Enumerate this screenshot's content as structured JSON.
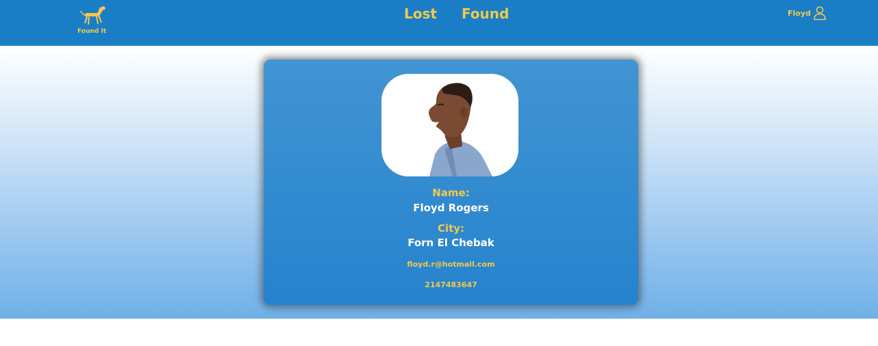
{
  "brand": {
    "name": "Found It",
    "icon": "dog-icon"
  },
  "nav": {
    "lost_label": "Lost",
    "found_label": "Found"
  },
  "user": {
    "name": "Floyd",
    "icon": "user-icon"
  },
  "profile": {
    "photo_icon": "profile-photo",
    "name_label": "Name:",
    "name_value": "Floyd Rogers",
    "city_label": "City:",
    "city_value": "Forn El Chebak",
    "email": "floyd.r@hotmail.com",
    "phone": "2147483647"
  },
  "colors": {
    "navbar": "#1a7ec6",
    "accent": "#f2c94c",
    "card_top": "#4294d3",
    "card_bottom": "#2583cd"
  }
}
